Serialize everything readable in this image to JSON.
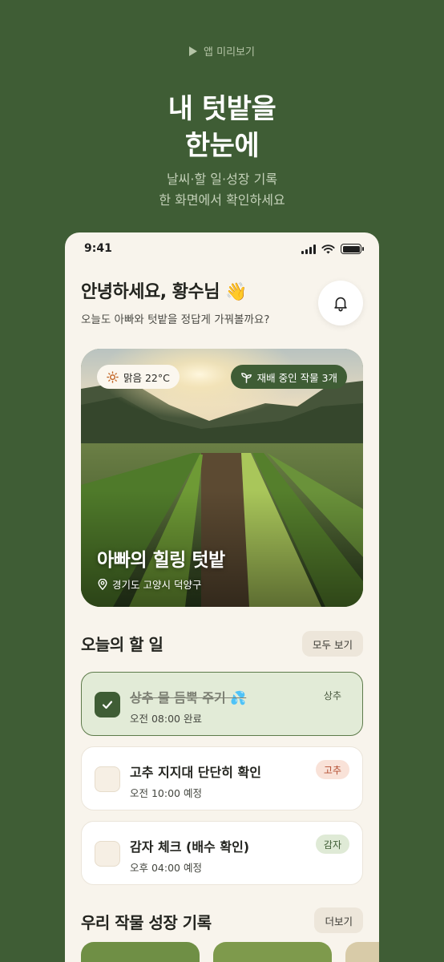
{
  "promo": {
    "preview_label": "앱 미리보기",
    "headline_line1": "내 텃밭을",
    "headline_line2": "한눈에",
    "sub_line1": "날씨·할 일·성장 기록",
    "sub_line2": "한 화면에서 확인하세요"
  },
  "status_bar": {
    "time": "9:41"
  },
  "header": {
    "greeting": "안녕하세요, 황수님 👋",
    "subtitle": "오늘도 아빠와 텃밭을 정답게 가꿔볼까요?"
  },
  "farm_card": {
    "weather": "맑음 22°C",
    "crops_badge": "재배 중인 작물 3개",
    "title": "아빠의 힐링 텃밭",
    "location": "경기도 고양시 덕양구"
  },
  "tasks_section": {
    "title": "오늘의 할 일",
    "view_all": "모두 보기",
    "items": [
      {
        "title": "상추 물 듬뿍 주기 💦",
        "time": "오전 08:00 완료",
        "tag": "상추",
        "done": true
      },
      {
        "title": "고추 지지대 단단히 확인",
        "time": "오전 10:00 예정",
        "tag": "고추",
        "done": false
      },
      {
        "title": "감자 체크 (배수 확인)",
        "time": "오후 04:00 예정",
        "tag": "감자",
        "done": false
      }
    ]
  },
  "growth_section": {
    "title": "우리 작물 성장 기록",
    "more": "더보기"
  },
  "colors": {
    "background": "#3f5d35",
    "phone_bg": "#f8f4ec",
    "accent_green": "#3f5d35",
    "pepper_tag": "#b44e31"
  }
}
